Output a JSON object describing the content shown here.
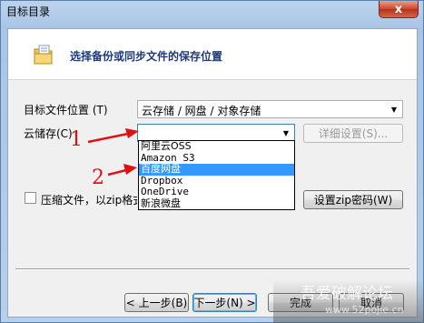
{
  "window": {
    "title": "目标目录",
    "close_glyph": "x"
  },
  "header": {
    "text": "选择备份或同步文件的保存位置",
    "icon": "folder-document-icon"
  },
  "target_location": {
    "label": "目标文件位置 (T)",
    "value": "云存储 / 网盘 / 对象存储"
  },
  "cloud_storage": {
    "label": "云储存(C)",
    "value": "",
    "details_button": "详细设置(S)...",
    "options": [
      "阿里云OSS",
      "Amazon S3",
      "百度网盘",
      "Dropbox",
      "OneDrive",
      "新浪微盘"
    ],
    "highlighted_option": "百度网盘"
  },
  "compress": {
    "label": "压缩文件，以zip格式",
    "password_button": "设置zip密码(W)"
  },
  "annotations": {
    "marker_1": "1",
    "marker_2": "2",
    "color": "#e01010"
  },
  "footer": {
    "prev_button": "< 上一步(B)",
    "next_button": "下一步(N) >",
    "finish_button": "完成",
    "cancel_button": "取消"
  },
  "watermark": {
    "line1": "吾爱破解论坛",
    "line2": "www.52pojie.cn"
  }
}
